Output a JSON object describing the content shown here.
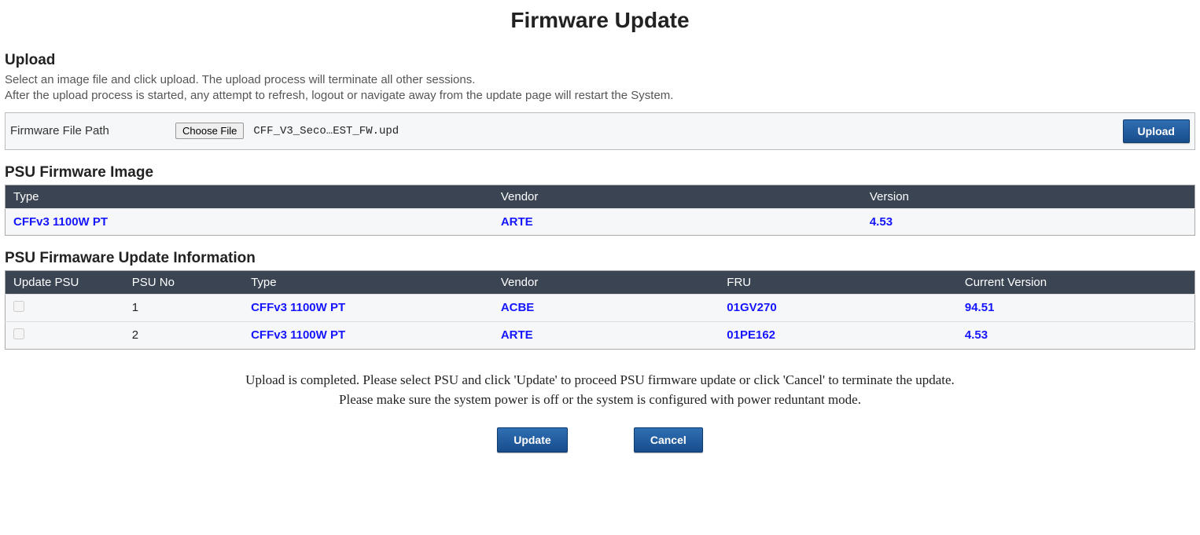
{
  "page": {
    "title": "Firmware Update"
  },
  "upload": {
    "section_title": "Upload",
    "desc_line1": "Select an image file and click upload. The upload process will terminate all other sessions.",
    "desc_line2": "After the upload process is started, any attempt to refresh, logout or navigate away from the update page will restart the System.",
    "path_label": "Firmware File Path",
    "choose_file_label": "Choose File",
    "file_name": "CFF_V3_Seco…EST_FW.upd",
    "upload_button": "Upload"
  },
  "psu_image": {
    "section_title": "PSU Firmware Image",
    "headers": {
      "type": "Type",
      "vendor": "Vendor",
      "version": "Version"
    },
    "row": {
      "type": "CFFv3 1100W PT",
      "vendor": "ARTE",
      "version": "4.53"
    }
  },
  "psu_info": {
    "section_title": "PSU Firmaware Update Information",
    "headers": {
      "update": "Update PSU",
      "no": "PSU No",
      "type": "Type",
      "vendor": "Vendor",
      "fru": "FRU",
      "version": "Current Version"
    },
    "rows": [
      {
        "no": "1",
        "type": "CFFv3 1100W PT",
        "vendor": "ACBE",
        "fru": "01GV270",
        "version": "94.51"
      },
      {
        "no": "2",
        "type": "CFFv3 1100W PT",
        "vendor": "ARTE",
        "fru": "01PE162",
        "version": "4.53"
      }
    ]
  },
  "status": {
    "line1": "Upload is completed. Please select PSU and click 'Update' to proceed PSU firmware update or click 'Cancel' to terminate the update.",
    "line2": "Please make sure the system power is off or the system is configured with power reduntant mode."
  },
  "buttons": {
    "update": "Update",
    "cancel": "Cancel"
  }
}
